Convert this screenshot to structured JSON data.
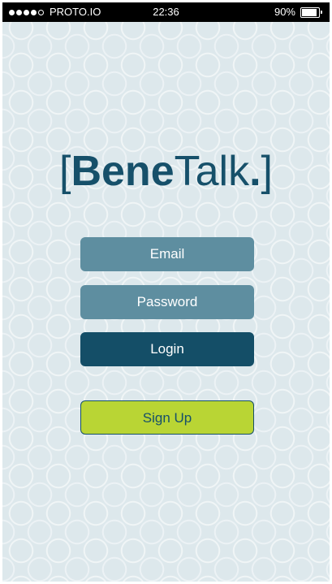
{
  "status_bar": {
    "carrier": "PROTO.IO",
    "time": "22:36",
    "battery_percent_label": "90%",
    "battery_level": 0.9,
    "signal_bars_filled": 4,
    "signal_bars_total": 5
  },
  "logo": {
    "open_bracket": "[",
    "bold_text": "Bene",
    "light_text": "Talk",
    "dot": ".",
    "close_bracket": "]"
  },
  "form": {
    "email_label": "Email",
    "password_label": "Password",
    "login_label": "Login",
    "signup_label": "Sign Up"
  },
  "colors": {
    "background": "#dde8ec",
    "brand_dark": "#16506a",
    "field": "#5e8ea0",
    "signup": "#b9d534"
  },
  "icons": {
    "battery": "battery-icon",
    "signal": "signal-dots-icon"
  }
}
